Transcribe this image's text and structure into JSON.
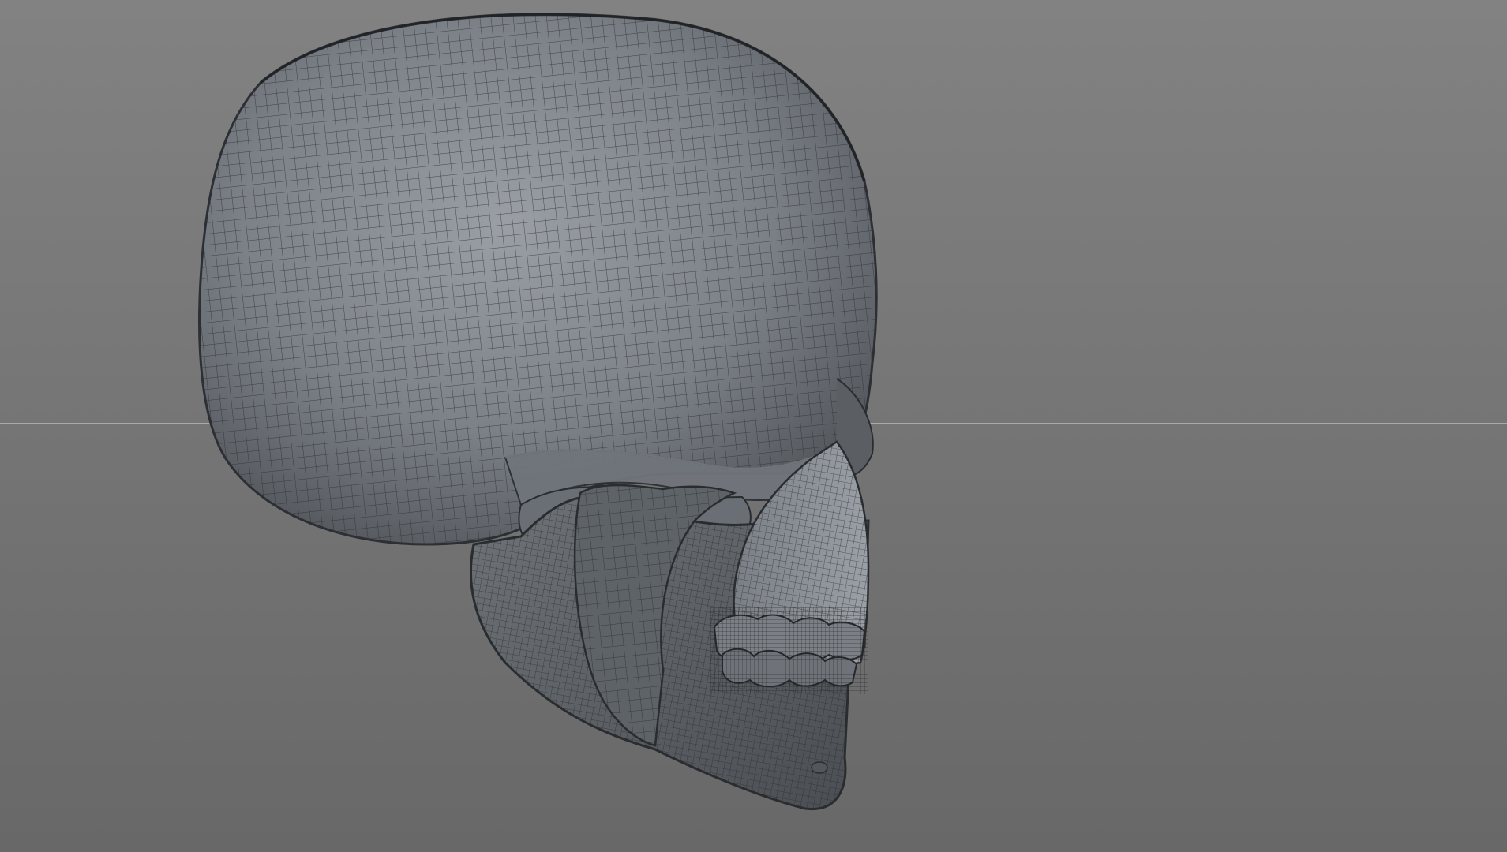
{
  "viewport": {
    "background_top": "#828282",
    "background_bottom": "#686868",
    "horizon_color": "#a9a9a9"
  },
  "model": {
    "name_icon": "skull-wireframe-mesh",
    "shading": "smooth-shaded-with-wireframe",
    "surface_color": "#7d8288",
    "wire_color": "#2a2d30"
  }
}
